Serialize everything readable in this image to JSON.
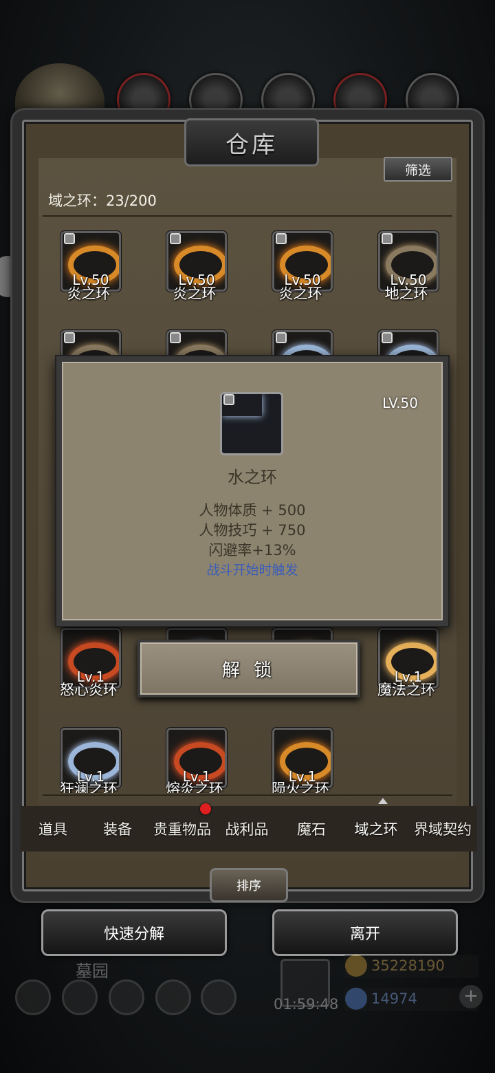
{
  "header": {
    "title": "仓库",
    "filter_label": "筛选",
    "count_label": "域之环：23/200"
  },
  "items_row1": [
    {
      "level": "Lv.50",
      "name": "炎之环",
      "ring": "fire"
    },
    {
      "level": "Lv.50",
      "name": "炎之环",
      "ring": "fire"
    },
    {
      "level": "Lv.50",
      "name": "炎之环",
      "ring": "fire"
    },
    {
      "level": "Lv.50",
      "name": "地之环",
      "ring": "earth"
    }
  ],
  "items_row3": [
    {
      "level": "Lv.1",
      "name": "怒心炎环",
      "ring": "fire2"
    },
    {
      "level": "Lv.1",
      "name": "魔法之环",
      "ring": "magic"
    }
  ],
  "items_row4": [
    {
      "level": "Lv.1",
      "name": "狂澜之环",
      "ring": "water"
    },
    {
      "level": "Lv.1",
      "name": "熔炎之环",
      "ring": "fire2"
    },
    {
      "level": "Lv.1",
      "name": "陨火之环",
      "ring": "fire"
    }
  ],
  "tooltip": {
    "level": "LV.50",
    "name": "水之环",
    "stats": [
      "人物体质 + 500",
      "人物技巧 + 750",
      "闪避率+13%"
    ],
    "trigger": "战斗开始时触发"
  },
  "unlock_label": "解 锁",
  "tabs": [
    "道具",
    "装备",
    "贵重物品",
    "战利品",
    "魔石",
    "域之环",
    "界域契约"
  ],
  "active_tab": "域之环",
  "sort_label": "排序",
  "buttons": {
    "quick_decompose": "快速分解",
    "leave": "离开"
  },
  "footer": {
    "location": "墓园",
    "timer": "01:59:48",
    "gold": "35228190",
    "gems": "14974",
    "plus": "+"
  },
  "colors": {
    "tooltip_bg": "#8d8470",
    "trigger_text": "#3b5db8",
    "badge_red": "#e02020"
  }
}
